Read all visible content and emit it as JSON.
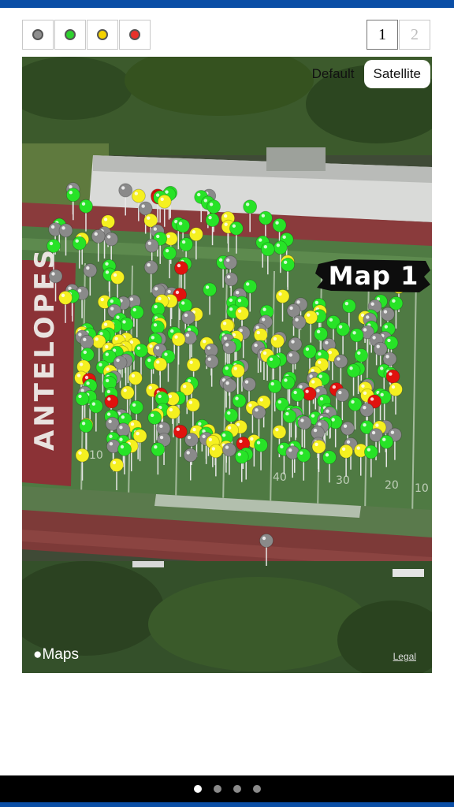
{
  "filters": [
    {
      "name": "gray",
      "color": "#8e8e8e"
    },
    {
      "name": "green",
      "color": "#2ed12e"
    },
    {
      "name": "yellow",
      "color": "#f4d200"
    },
    {
      "name": "red",
      "color": "#e8312a"
    }
  ],
  "pager": {
    "pages": [
      "1",
      "2"
    ],
    "current": "1"
  },
  "map": {
    "type_options": {
      "default": "Default",
      "satellite": "Satellite"
    },
    "selected_type": "Satellite",
    "label": "Map 1",
    "field_text": "ANTELOPES",
    "yard_numbers": [
      "10",
      "40",
      "30",
      "20",
      "10"
    ],
    "attribution": "Maps",
    "legal": "Legal",
    "pin_colors": {
      "gray": "#8a8a8a",
      "green": "#27e327",
      "yellow": "#f5f020",
      "red": "#e0120e"
    }
  },
  "page_indicator": {
    "count": 4,
    "current": 0
  }
}
